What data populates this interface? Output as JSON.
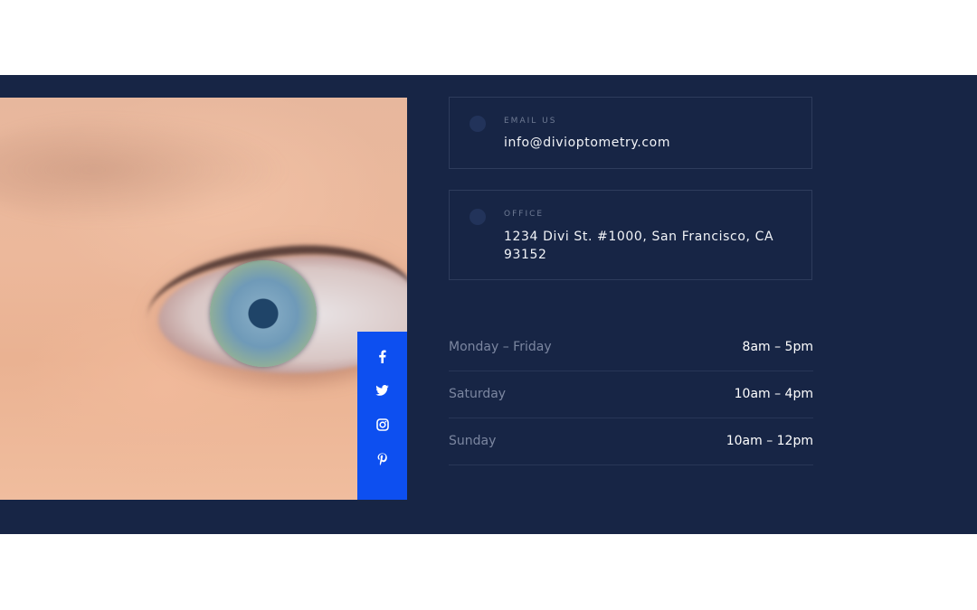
{
  "contact": {
    "email": {
      "label": "Email Us",
      "value": "info@divioptometry.com",
      "icon": "envelope-icon"
    },
    "office": {
      "label": "Office",
      "value": "1234 Divi St. #1000, San Francisco, CA 93152",
      "icon": "map-pin-icon"
    }
  },
  "hours": [
    {
      "day": "Monday – Friday",
      "time": "8am – 5pm"
    },
    {
      "day": "Saturday",
      "time": "10am – 4pm"
    },
    {
      "day": "Sunday",
      "time": "10am – 12pm"
    }
  ],
  "social": [
    {
      "name": "facebook-icon"
    },
    {
      "name": "twitter-icon"
    },
    {
      "name": "instagram-icon"
    },
    {
      "name": "pinterest-icon"
    }
  ],
  "colors": {
    "background": "#172545",
    "accent": "#0d4ff0",
    "text": "#f2f4f8",
    "muted": "#7b86a0"
  }
}
